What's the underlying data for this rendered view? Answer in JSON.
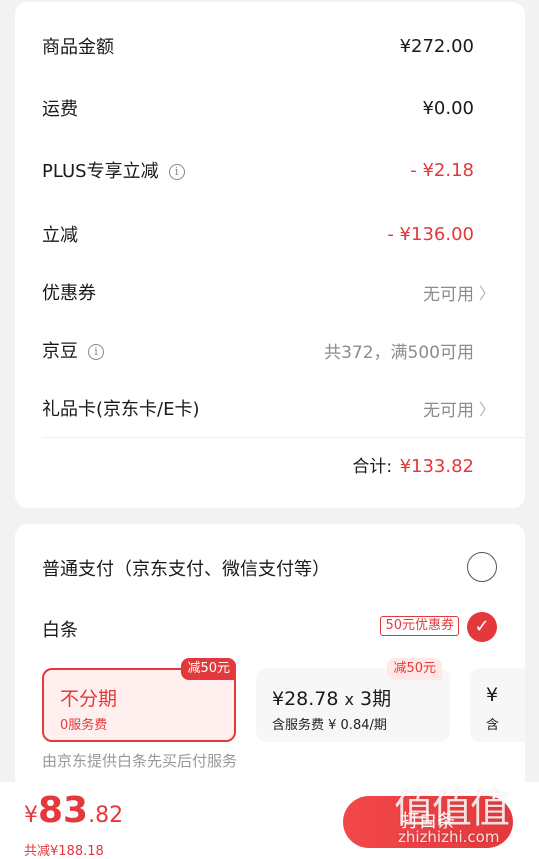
{
  "summary": {
    "rows": [
      {
        "label": "商品金额",
        "value": "¥272.00"
      },
      {
        "label": "运费",
        "value": "¥0.00"
      },
      {
        "label": "PLUS专享立减",
        "value": "- ¥2.18"
      },
      {
        "label": "立减",
        "value": "- ¥136.00"
      },
      {
        "label": "优惠券",
        "value": "无可用"
      },
      {
        "label": "京豆",
        "value": "共372，满500可用"
      },
      {
        "label": "礼品卡(京东卡/E卡)",
        "value": "无可用"
      }
    ],
    "total_label": "合计:",
    "total_value": "¥133.82"
  },
  "payment": {
    "normal_label": "普通支付（京东支付、微信支付等）",
    "baitiao_label": "白条",
    "coupon_tag": "50元优惠券",
    "plans": [
      {
        "title": "不分期",
        "sub": "0服务费",
        "badge": "减50元",
        "selected": true
      },
      {
        "title_prefix": "¥28.78",
        "title_x": "x",
        "title_suffix": "3期",
        "sub": "含服务费 ¥ 0.84/期",
        "badge": "减50元"
      },
      {
        "title": "¥",
        "sub": "含"
      }
    ],
    "note": "由京东提供白条先买后付服务"
  },
  "bottom": {
    "yen": "¥",
    "price_int": "83",
    "price_dec": ".82",
    "saved": "共减¥188.18",
    "button": "打白条"
  },
  "watermark": {
    "big": "值值值",
    "small": "zhizhizhi.com"
  },
  "colors": {
    "accent": "#e4393c",
    "background": "#f2f2f2"
  }
}
